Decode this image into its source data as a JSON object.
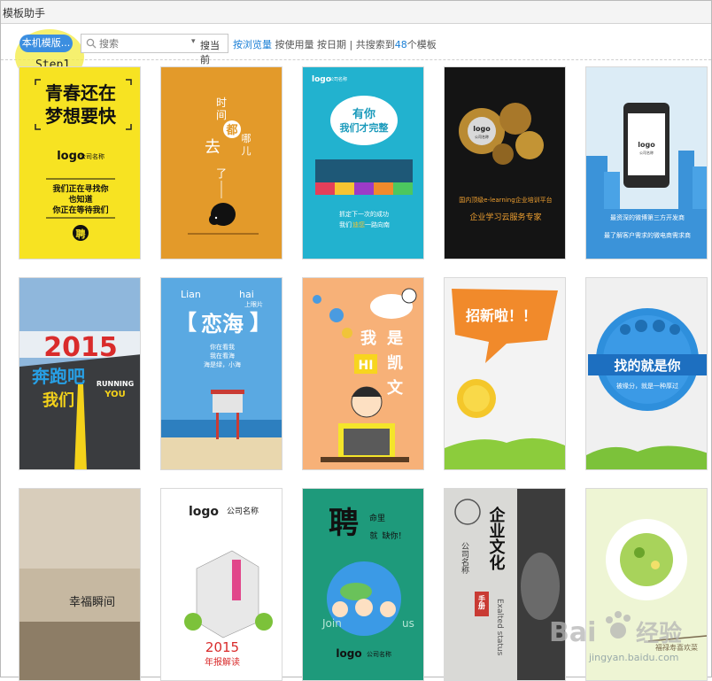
{
  "window": {
    "title": "模板助手"
  },
  "toolbar": {
    "local_templates": "本机模版...",
    "step_label": "Step1",
    "search_placeholder": "搜索",
    "search_scope": "搜当前",
    "sort_browse": "按浏览量",
    "sort_usage": "按使用量",
    "sort_date": "按日期",
    "result_prefix": "共搜索到",
    "result_count": "48",
    "result_suffix": "个模板"
  },
  "templates": [
    {
      "name": "youth-dream",
      "lines": [
        "青春还在",
        "梦想要快",
        "logo",
        "公司名称",
        "我们正在寻找你",
        "也知道",
        "你正在等待我们",
        "聘"
      ]
    },
    {
      "name": "time-gone",
      "lines": [
        "时",
        "间",
        "都",
        "去",
        "哪",
        "儿",
        "了"
      ]
    },
    {
      "name": "puzzle-team",
      "lines": [
        "logo",
        "公司名称",
        "有你",
        "我们才完整",
        "抓定下一次的成功",
        "我们",
        "迪您",
        "一路向南"
      ]
    },
    {
      "name": "gears",
      "lines": [
        "logo",
        "公司名称",
        "国内顶级e-learning企业培训平台",
        "企业学习云服务专家"
      ]
    },
    {
      "name": "phone",
      "lines": [
        "logo",
        "公司名称",
        "最资深的微博第三方开发商",
        "最了解客户需求的微电商需求商"
      ]
    },
    {
      "name": "run-2015",
      "lines": [
        "2015",
        "奔跑吧",
        "我们",
        "RUNNING",
        "YOU"
      ]
    },
    {
      "name": "sea-love",
      "lines": [
        "Lian",
        "hai",
        "上眼片",
        "恋海",
        "你在看我",
        "我在看海",
        "海是绿，小海"
      ]
    },
    {
      "name": "hi-recruit",
      "lines": [
        "我",
        "是",
        "HI",
        "凯",
        "文"
      ]
    },
    {
      "name": "recruiting",
      "lines": [
        "招新啦！！"
      ]
    },
    {
      "name": "find-you",
      "lines": [
        "找的就是你",
        "被缘分，就是一种厚过"
      ]
    },
    {
      "name": "happy-moment",
      "lines": [
        "幸福瞬间"
      ]
    },
    {
      "name": "annual-2015",
      "lines": [
        "logo",
        "公司名称",
        "2015",
        "年报解读"
      ]
    },
    {
      "name": "hire-world",
      "lines": [
        "聘",
        "命里",
        "就",
        "缺你！",
        "Join",
        "us",
        "logo",
        "公司名称"
      ]
    },
    {
      "name": "corp-culture",
      "lines": [
        "企业文化",
        "手册",
        "公司名称",
        "Exalted status"
      ]
    },
    {
      "name": "food-plate",
      "lines": [
        "福禄寿喜欢菜"
      ]
    }
  ],
  "watermark": {
    "brand": "Bai",
    "brand2": "经验",
    "url": "jingyan.baidu.com"
  },
  "colors": {
    "accent": "#1a7fd6",
    "button": "#3b8ee0",
    "highlight": "#f4ec46"
  }
}
